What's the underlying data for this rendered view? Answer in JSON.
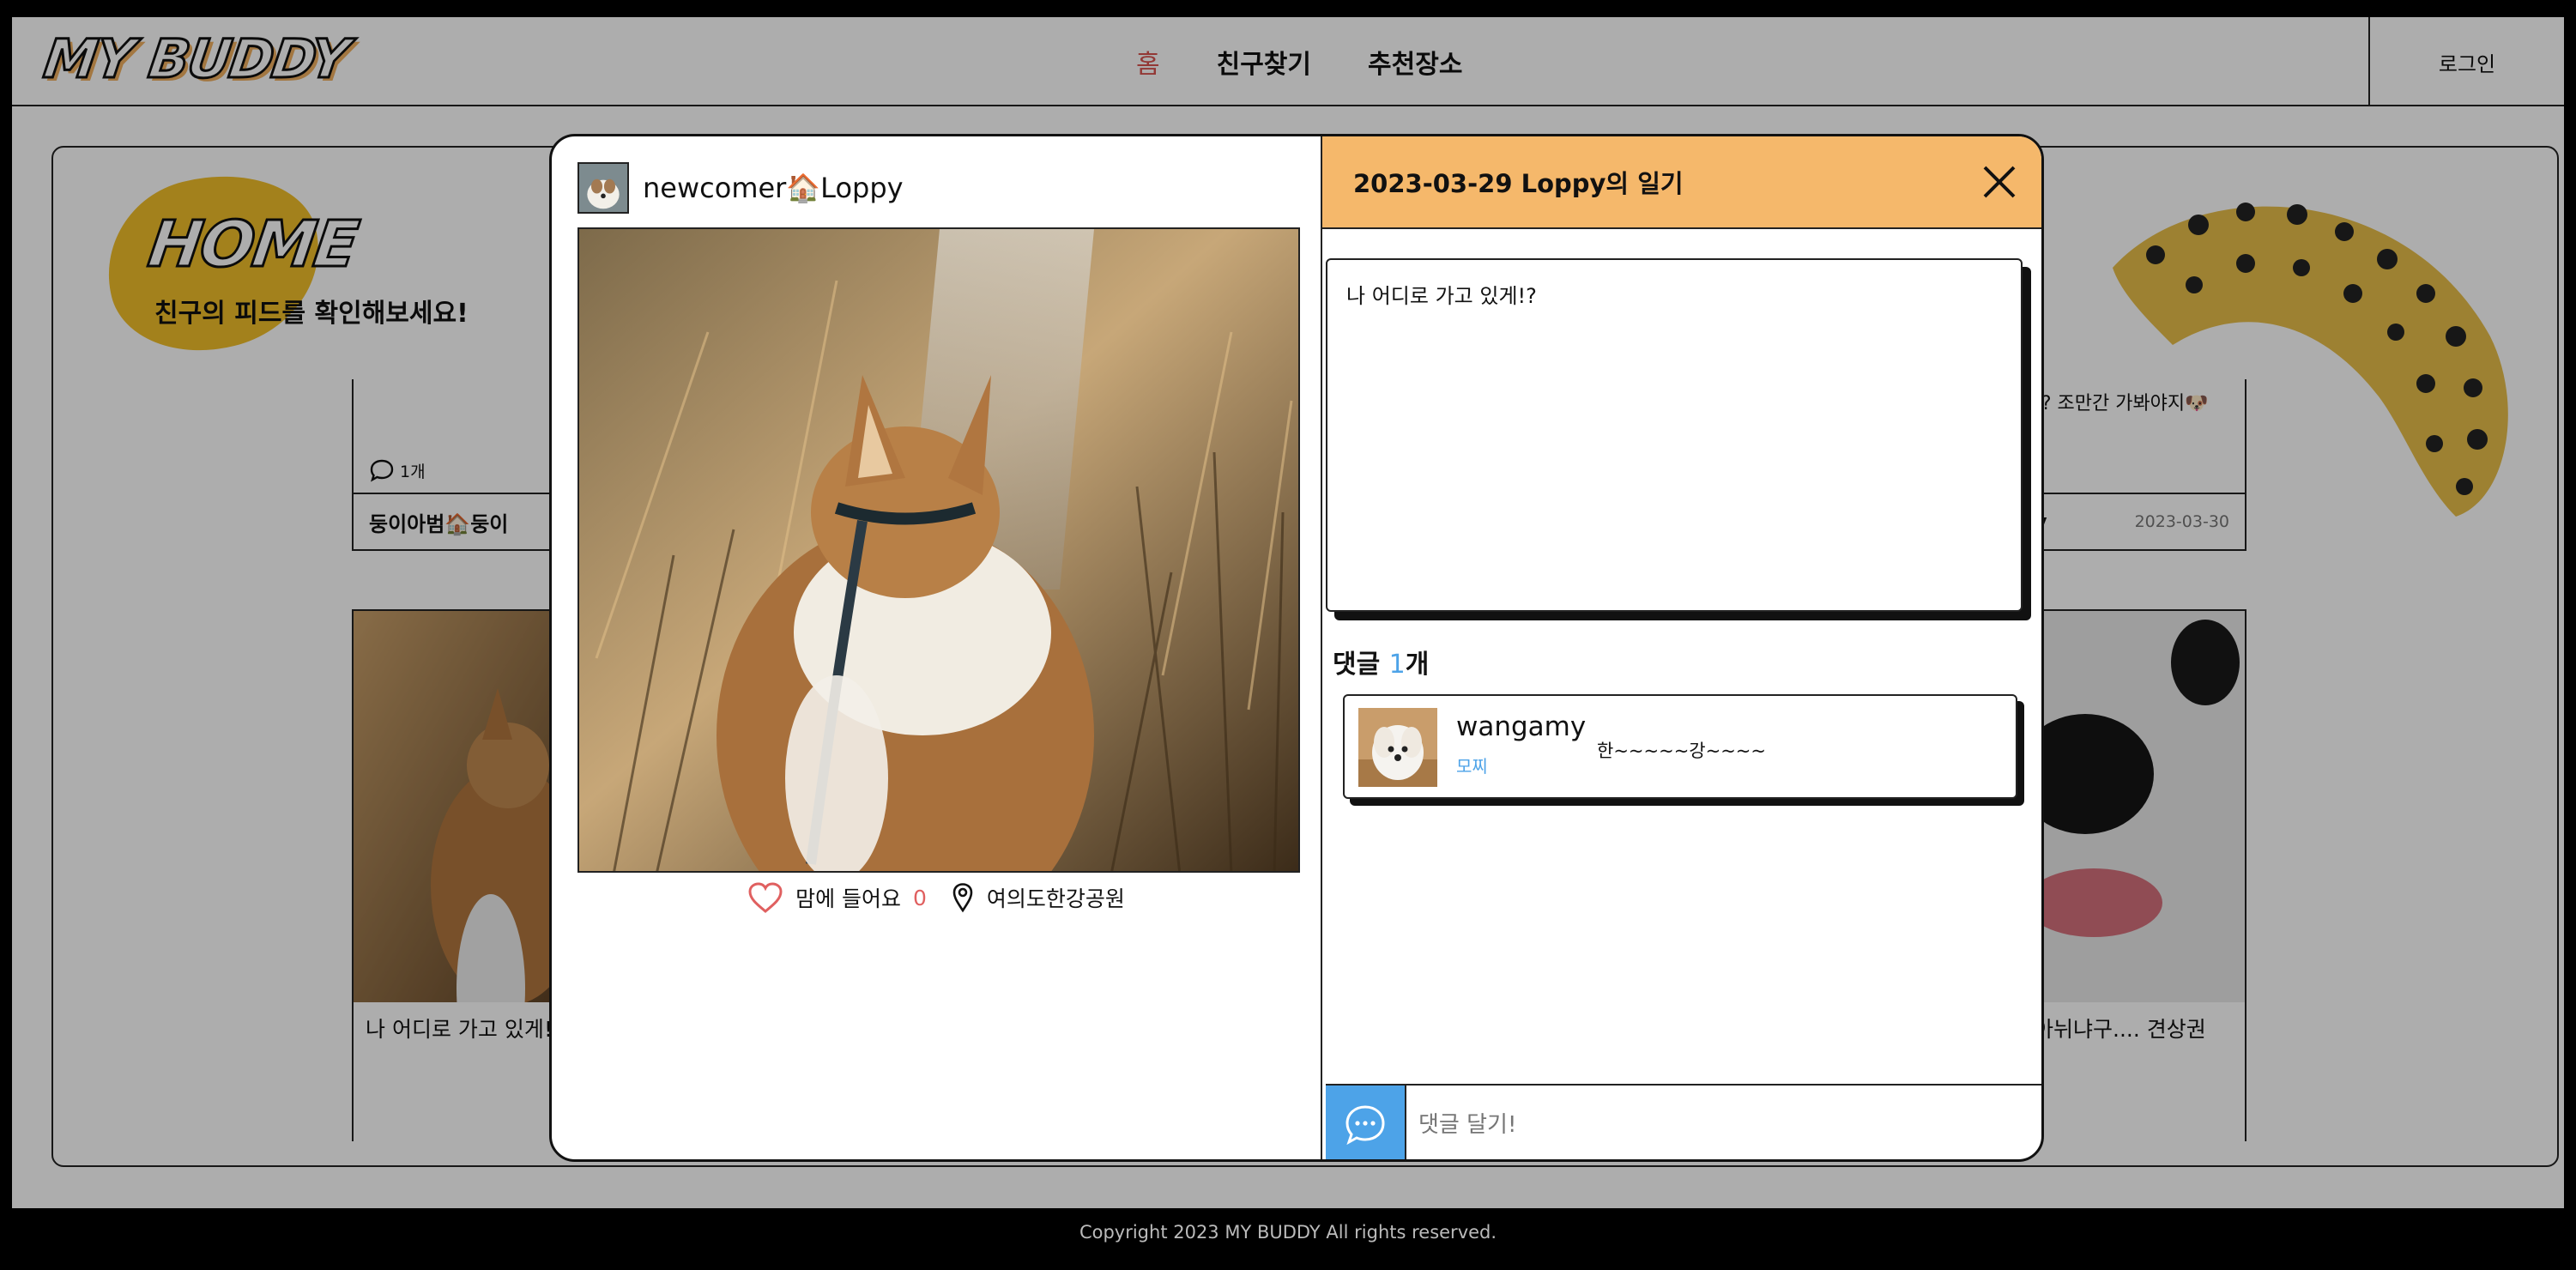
{
  "header": {
    "logo": "MY BUDDY",
    "nav": [
      {
        "label": "홈",
        "active": true
      },
      {
        "label": "친구찾기",
        "active": false
      },
      {
        "label": "추천장소",
        "active": false
      }
    ],
    "login_label": "로그인"
  },
  "home": {
    "title": "HOME",
    "subtitle": "친구의 피드를 확인해보세요!"
  },
  "feed": {
    "card1": {
      "comment_count": "1개",
      "author": "둥이아범🏠둥이"
    },
    "card2": {
      "text": "!? 조만간 가봐야지🐶",
      "author": "y",
      "date": "2023-03-30"
    },
    "card3": {
      "text": "나 어디로 가고 있게!?"
    },
    "card4": {
      "text": "아뉘냐구.... 견상권"
    }
  },
  "modal": {
    "author": "newcomer🏠Loppy",
    "like_label": "맘에 들어요",
    "like_count": "0",
    "location": "여의도한강공원",
    "diary_title": "2023-03-29 Loppy의 일기",
    "diary_text": "나 어디로 가고 있게!?",
    "comments_prefix": "댓글 ",
    "comments_count": "1",
    "comments_suffix": "개",
    "comment": {
      "user": "wangamy",
      "breed": "모찌",
      "text": "한~~~~~강~~~~"
    },
    "comment_placeholder": "댓글 달기!"
  },
  "footer": {
    "copyright": "Copyright 2023 MY BUDDY All rights reserved."
  },
  "colors": {
    "accent": "#f5b86b",
    "blue": "#4da3e8",
    "active_nav": "#d9534f",
    "yellow": "#f1bf2a"
  }
}
